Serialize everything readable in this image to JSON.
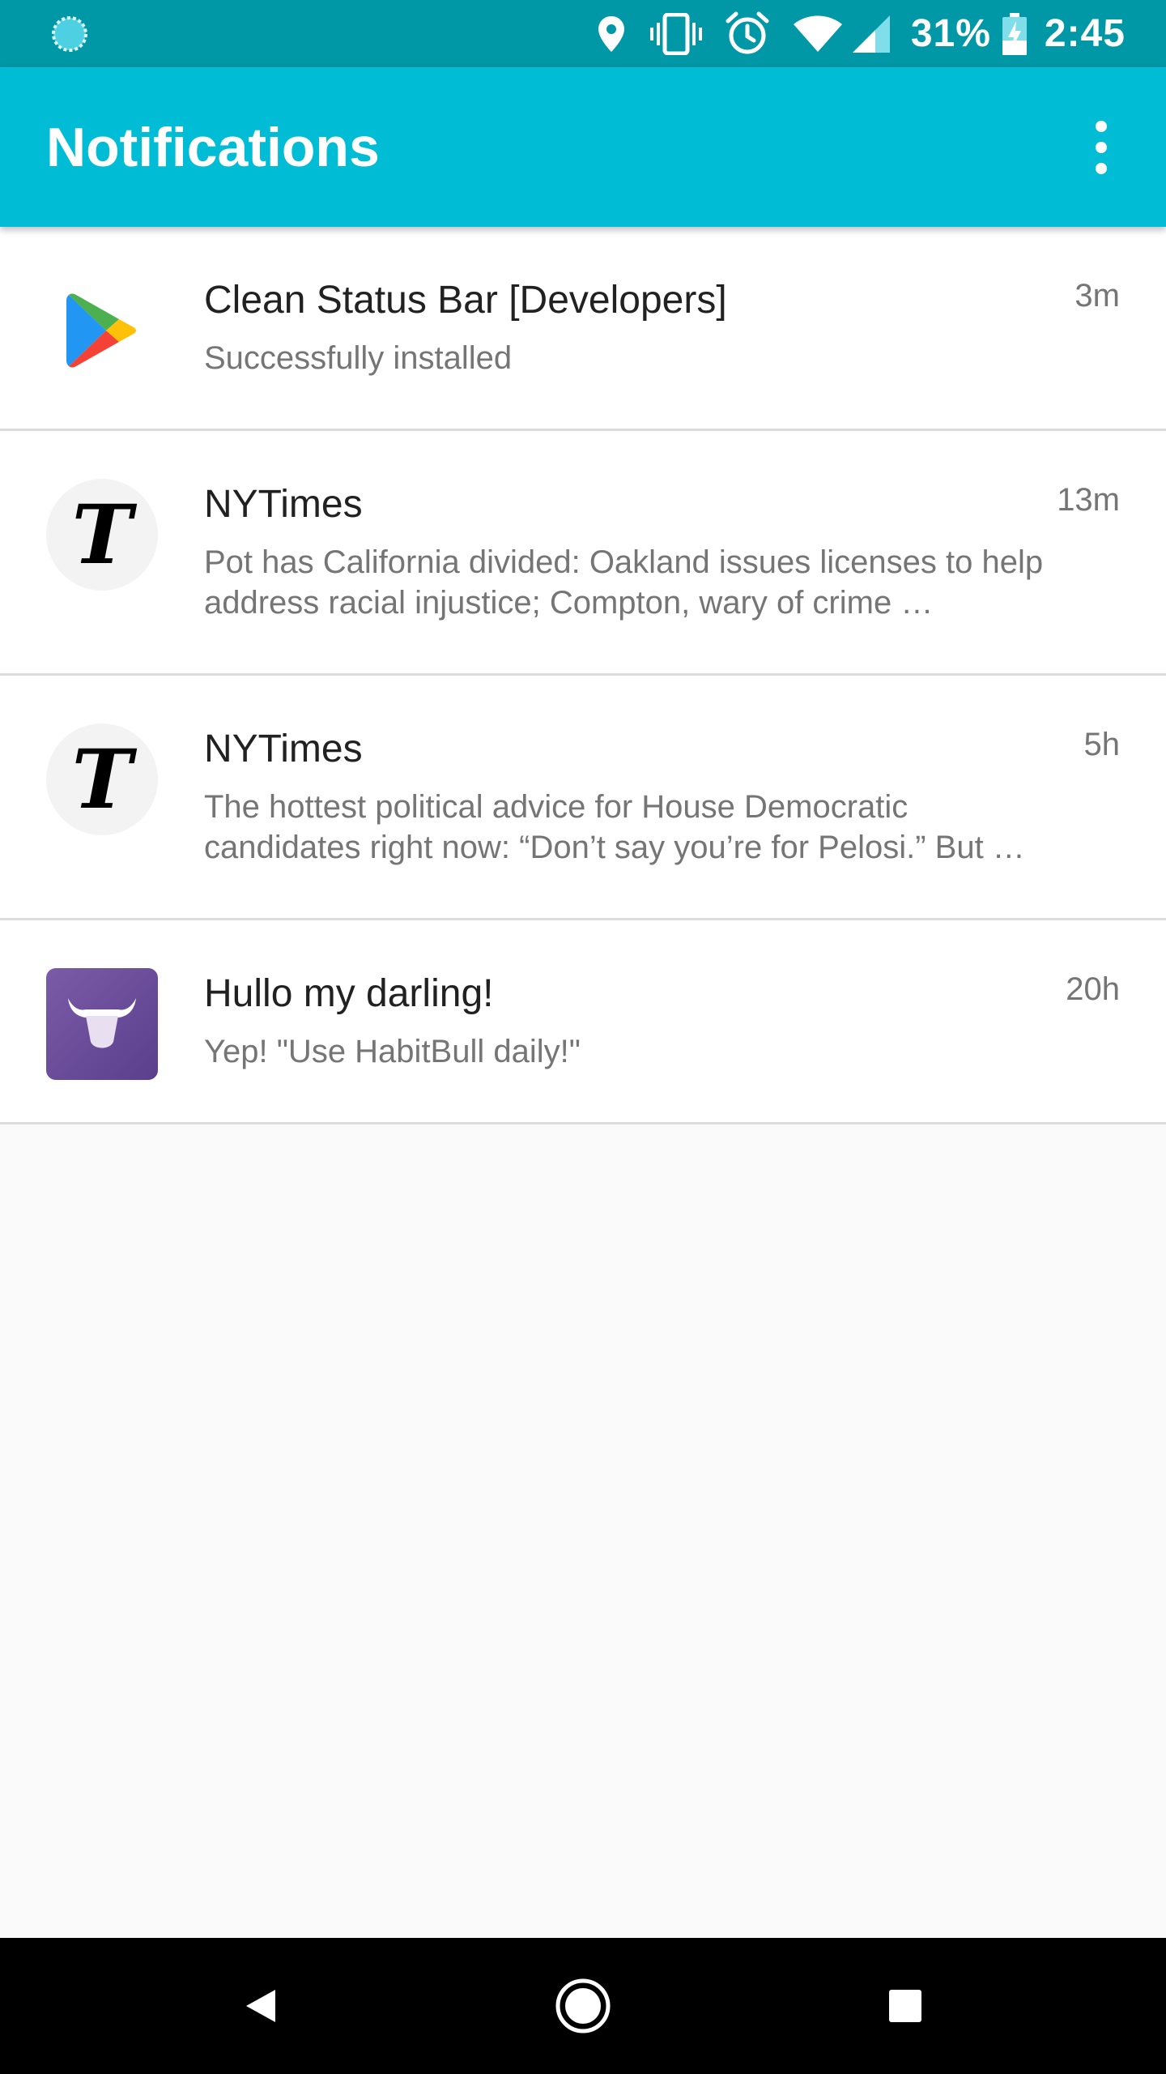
{
  "status_bar": {
    "battery_text": "31%",
    "time": "2:45",
    "icons": [
      "loading-icon",
      "location-icon",
      "vibrate-icon",
      "alarm-icon",
      "wifi-icon",
      "signal-icon",
      "battery-charging-icon"
    ],
    "background": "#0097a7"
  },
  "app_bar": {
    "title": "Notifications",
    "background": "#00bcd4",
    "menu_icon": "more-vert-icon"
  },
  "notifications": [
    {
      "app_icon": "google-play-icon",
      "title": "Clean Status Bar [Developers]",
      "body": "Successfully installed",
      "time": "3m"
    },
    {
      "app_icon": "nytimes-icon",
      "title": "NYTimes",
      "body": "Pot has California divided: Oakland issues licenses to help address racial injustice; Compton, wary of crime …",
      "time": "13m"
    },
    {
      "app_icon": "nytimes-icon",
      "title": "NYTimes",
      "body": "The hottest political advice for House Democratic candidates right now: “Don’t say you’re for Pelosi.” But …",
      "time": "5h"
    },
    {
      "app_icon": "habitbull-icon",
      "title": "Hullo my darling!",
      "body": "Yep! \"Use HabitBull daily!\"",
      "time": "20h"
    }
  ],
  "nav_bar": {
    "buttons": [
      "back-icon",
      "home-icon",
      "recents-icon"
    ]
  },
  "colors": {
    "title_text": "#212121",
    "secondary_text": "#757575",
    "divider": "#dcdcdc",
    "list_bg": "#fafafa"
  }
}
